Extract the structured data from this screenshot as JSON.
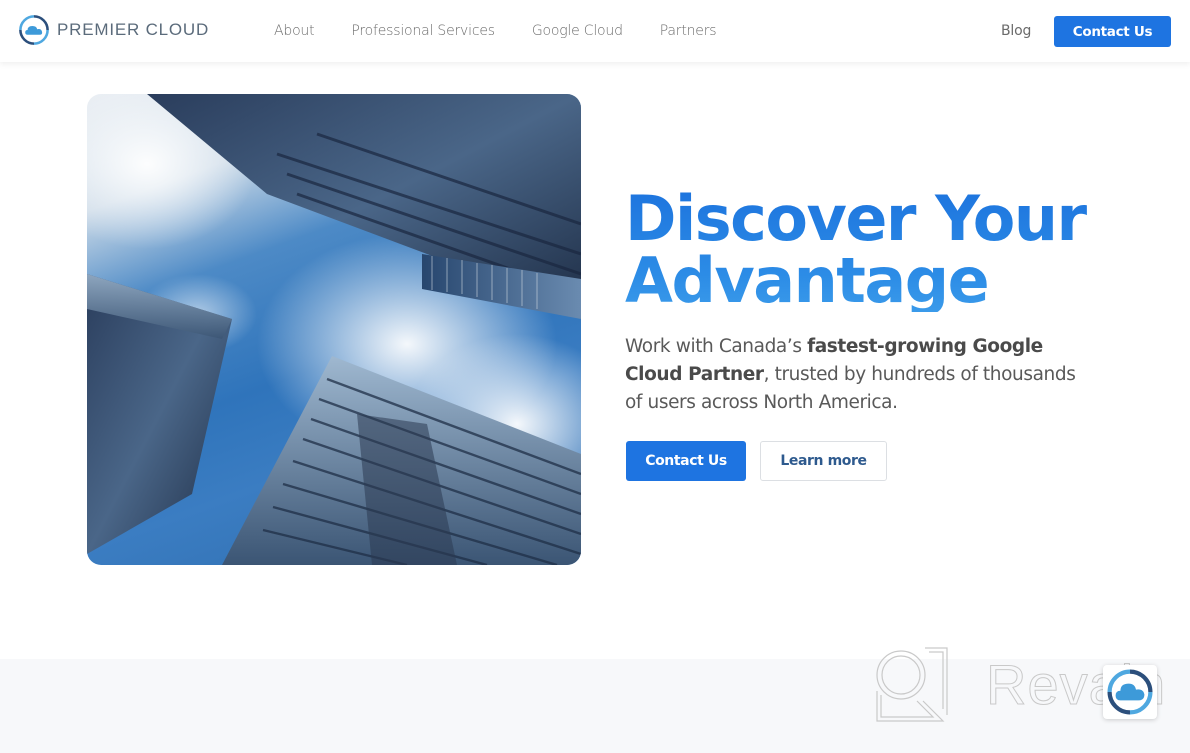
{
  "brand": {
    "name": "PREMIER CLOUD",
    "logo_icon": "cloud-ring-logo-icon",
    "primary_color": "#1e74e1",
    "accent_light": "#4fa8e0",
    "accent_dark": "#2c4f7c"
  },
  "header": {
    "nav": [
      {
        "label": "About"
      },
      {
        "label": "Professional Services"
      },
      {
        "label": "Google Cloud"
      },
      {
        "label": "Partners"
      }
    ],
    "blog_label": "Blog",
    "cta_label": "Contact Us"
  },
  "hero": {
    "image_alt": "Upward view of glass skyscrapers against a cloudy blue sky",
    "title_line1": "Discover Your",
    "title_line2": "Advantage",
    "desc_part1": "Work with Canada’s ",
    "desc_bold": "fastest-growing Google Cloud Partner",
    "desc_part2": ", trusted by hundreds of thousands of users across North America.",
    "primary_button": "Contact Us",
    "secondary_button": "Learn more"
  },
  "watermark": {
    "text": "Revain",
    "icon": "revain-logo-icon"
  },
  "chat_widget": {
    "icon": "cloud-ring-logo-icon"
  }
}
